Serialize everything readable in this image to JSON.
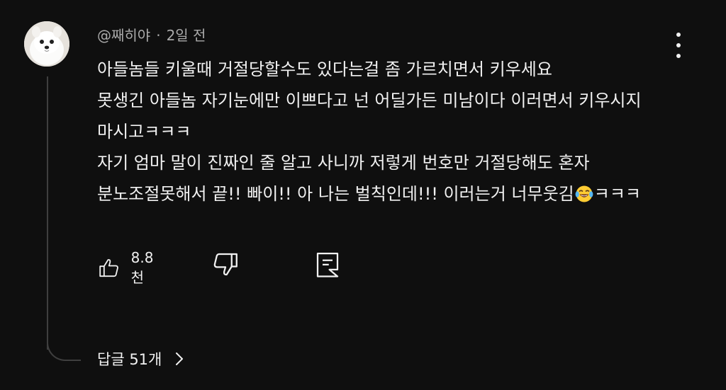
{
  "comment": {
    "author": "@째히야",
    "separator": "·",
    "time": "2일 전",
    "lines": [
      "아들놈들 키울때 거절당할수도 있다는걸 좀 가르치면서 키우세요",
      "못생긴 아들놈 자기눈에만 이쁘다고 넌 어딜가든 미남이다 이러면서 키우시지",
      "마시고ㅋㅋㅋ",
      "자기 엄마 말이 진짜인 줄 알고 사니까 저렇게 번호만 거절당해도 혼자",
      "분노조절못해서 끝!! 빠이!! 아 나는 벌칙인데!!! 이러는거 너무웃김"
    ],
    "line5_suffix": "ㅋㅋㅋ",
    "emoji": "face-with-tears-of-joy-icon"
  },
  "actions": {
    "like_count": "8.8천"
  },
  "replies": {
    "label": "답글 51개"
  },
  "colors": {
    "background": "#0f0f0f",
    "text": "#f1f1f1",
    "meta": "#aaaaaa",
    "thread": "#3f3f3f"
  }
}
